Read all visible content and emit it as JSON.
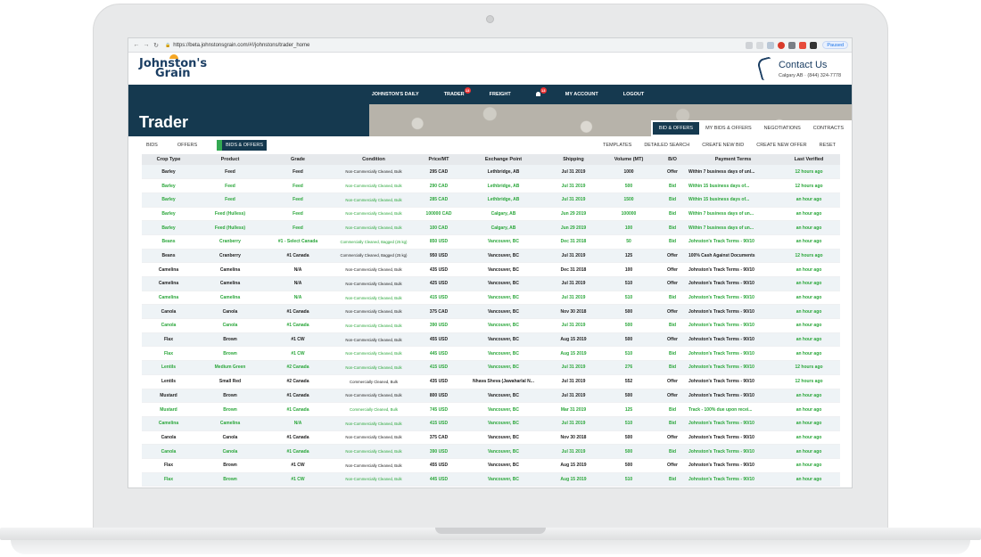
{
  "browser": {
    "url": "https://beta.johnstonsgrain.com/#!/johnstons/trader_home",
    "paused_label": "Paused"
  },
  "site": {
    "logo_line1": "Johnston's",
    "logo_line2": "Grain",
    "contact_title": "Contact Us",
    "contact_sub": "Calgary AB · (844) 324-7778"
  },
  "nav": {
    "items": [
      {
        "label": "JOHNSTON'S DAILY",
        "badge": ""
      },
      {
        "label": "TRADER",
        "badge": "13"
      },
      {
        "label": "FREIGHT",
        "badge": ""
      },
      {
        "label": "",
        "badge": "13",
        "icon": "bell-icon"
      },
      {
        "label": "MY ACCOUNT",
        "badge": ""
      },
      {
        "label": "LOGOUT",
        "badge": ""
      }
    ]
  },
  "hero": {
    "title": "Trader",
    "tabs": [
      "BID & OFFERS",
      "MY BIDS & OFFERS",
      "NEGOTIATIONS",
      "CONTRACTS"
    ]
  },
  "toolbar": {
    "left": [
      "BIDS",
      "OFFERS",
      "BIDS & OFFERS"
    ],
    "right": [
      "TEMPLATES",
      "DETAILED SEARCH",
      "CREATE NEW BID",
      "CREATE NEW OFFER",
      "RESET"
    ]
  },
  "table": {
    "headers": [
      "Crop Type",
      "Product",
      "Grade",
      "Condition",
      "Price/MT",
      "Exchange Point",
      "Shipping",
      "Volume (MT)",
      "B/O",
      "Payment Terms",
      "Last Verified"
    ],
    "rows": [
      [
        "Barley",
        "Feed",
        "Feed",
        "Non-Commercially Cleaned, Bulk",
        "295 CAD",
        "Lethbridge, AB",
        "Jul 31 2019",
        "1000",
        "Offer",
        "Within 7 business days of unl...",
        "12 hours ago"
      ],
      [
        "Barley",
        "Feed",
        "Feed",
        "Non-Commercially Cleaned, Bulk",
        "290 CAD",
        "Lethbridge, AB",
        "Jul 31 2019",
        "500",
        "Bid",
        "Within 15 business days of...",
        "12 hours ago"
      ],
      [
        "Barley",
        "Feed",
        "Feed",
        "Non-Commercially Cleaned, Bulk",
        "285 CAD",
        "Lethbridge, AB",
        "Jul 31 2019",
        "1500",
        "Bid",
        "Within 15 business days of...",
        "an hour ago"
      ],
      [
        "Barley",
        "Feed (Hulless)",
        "Feed",
        "Non-Commercially Cleaned, Bulk",
        "100000 CAD",
        "Calgary, AB",
        "Jun 29 2019",
        "100000",
        "Bid",
        "Within 7 business days of un...",
        "an hour ago"
      ],
      [
        "Barley",
        "Feed (Hulless)",
        "Feed",
        "Non-Commercially Cleaned, Bulk",
        "100 CAD",
        "Calgary, AB",
        "Jun 29 2019",
        "100",
        "Bid",
        "Within 7 business days of un...",
        "an hour ago"
      ],
      [
        "Beans",
        "Cranberry",
        "#1 - Select Canada",
        "Commercially Cleaned, Bagged (25 kg)",
        "850 USD",
        "Vancouver, BC",
        "Dec 31 2018",
        "50",
        "Bid",
        "Johnston's Track Terms - 90/10",
        "an hour ago"
      ],
      [
        "Beans",
        "Cranberry",
        "#1 Canada",
        "Commercially Cleaned, Bagged (25 kg)",
        "950 USD",
        "Vancouver, BC",
        "Jul 31 2019",
        "125",
        "Offer",
        "100% Cash Against Documents",
        "12 hours ago"
      ],
      [
        "Camelina",
        "Camelina",
        "N/A",
        "Non-Commercially Cleaned, Bulk",
        "435 USD",
        "Vancouver, BC",
        "Dec 31 2018",
        "100",
        "Offer",
        "Johnston's Track Terms - 90/10",
        "an hour ago"
      ],
      [
        "Camelina",
        "Camelina",
        "N/A",
        "Non-Commercially Cleaned, Bulk",
        "425 USD",
        "Vancouver, BC",
        "Jul 31 2019",
        "510",
        "Offer",
        "Johnston's Track Terms - 90/10",
        "an hour ago"
      ],
      [
        "Camelina",
        "Camelina",
        "N/A",
        "Non-Commercially Cleaned, Bulk",
        "415 USD",
        "Vancouver, BC",
        "Jul 31 2019",
        "510",
        "Bid",
        "Johnston's Track Terms - 90/10",
        "an hour ago"
      ],
      [
        "Canola",
        "Canola",
        "#1 Canada",
        "Non-Commercially Cleaned, Bulk",
        "375 CAD",
        "Vancouver, BC",
        "Nov 30 2018",
        "500",
        "Offer",
        "Johnston's Track Terms - 90/10",
        "an hour ago"
      ],
      [
        "Canola",
        "Canola",
        "#1 Canada",
        "Non-Commercially Cleaned, Bulk",
        "390 USD",
        "Vancouver, BC",
        "Jul 31 2019",
        "500",
        "Bid",
        "Johnston's Track Terms - 90/10",
        "an hour ago"
      ],
      [
        "Flax",
        "Brown",
        "#1 CW",
        "Non-Commercially Cleaned, Bulk",
        "455 USD",
        "Vancouver, BC",
        "Aug 15 2019",
        "500",
        "Offer",
        "Johnston's Track Terms - 90/10",
        "an hour ago"
      ],
      [
        "Flax",
        "Brown",
        "#1 CW",
        "Non-Commercially Cleaned, Bulk",
        "445 USD",
        "Vancouver, BC",
        "Aug 15 2019",
        "510",
        "Bid",
        "Johnston's Track Terms - 90/10",
        "an hour ago"
      ],
      [
        "Lentils",
        "Medium Green",
        "#2 Canada",
        "Non-Commercially Cleaned, Bulk",
        "415 USD",
        "Vancouver, BC",
        "Jul 31 2019",
        "276",
        "Bid",
        "Johnston's Track Terms - 90/10",
        "12 hours ago"
      ],
      [
        "Lentils",
        "Small Red",
        "#2 Canada",
        "Commercially Cleaned, Bulk",
        "435 USD",
        "Nhava Sheva (Jawaharlal N...",
        "Jul 31 2019",
        "552",
        "Offer",
        "Johnston's Track Terms - 90/10",
        "12 hours ago"
      ],
      [
        "Mustard",
        "Brown",
        "#1 Canada",
        "Non-Commercially Cleaned, Bulk",
        "800 USD",
        "Vancouver, BC",
        "Jul 31 2019",
        "500",
        "Offer",
        "Johnston's Track Terms - 90/10",
        "an hour ago"
      ],
      [
        "Mustard",
        "Brown",
        "#1 Canada",
        "Commercially Cleaned, Bulk",
        "745 USD",
        "Vancouver, BC",
        "Mar 31 2019",
        "125",
        "Bid",
        "Track - 100% due upon recei...",
        "an hour ago"
      ],
      [
        "Camelina",
        "Camelina",
        "N/A",
        "Non-Commercially Cleaned, Bulk",
        "415 USD",
        "Vancouver, BC",
        "Jul 31 2019",
        "510",
        "Bid",
        "Johnston's Track Terms - 90/10",
        "an hour ago"
      ],
      [
        "Canola",
        "Canola",
        "#1 Canada",
        "Non-Commercially Cleaned, Bulk",
        "375 CAD",
        "Vancouver, BC",
        "Nov 30 2018",
        "500",
        "Offer",
        "Johnston's Track Terms - 90/10",
        "an hour ago"
      ],
      [
        "Canola",
        "Canola",
        "#1 Canada",
        "Non-Commercially Cleaned, Bulk",
        "390 USD",
        "Vancouver, BC",
        "Jul 31 2019",
        "500",
        "Bid",
        "Johnston's Track Terms - 90/10",
        "an hour ago"
      ],
      [
        "Flax",
        "Brown",
        "#1 CW",
        "Non-Commercially Cleaned, Bulk",
        "455 USD",
        "Vancouver, BC",
        "Aug 15 2019",
        "500",
        "Offer",
        "Johnston's Track Terms - 90/10",
        "an hour ago"
      ],
      [
        "Flax",
        "Brown",
        "#1 CW",
        "Non-Commercially Cleaned, Bulk",
        "445 USD",
        "Vancouver, BC",
        "Aug 15 2019",
        "510",
        "Bid",
        "Johnston's Track Terms - 90/10",
        "an hour ago"
      ]
    ]
  },
  "colors": {
    "navy": "#15394f",
    "green": "#2aa63a",
    "bid_text": "#2aa63a",
    "offer_text": "#222222"
  }
}
